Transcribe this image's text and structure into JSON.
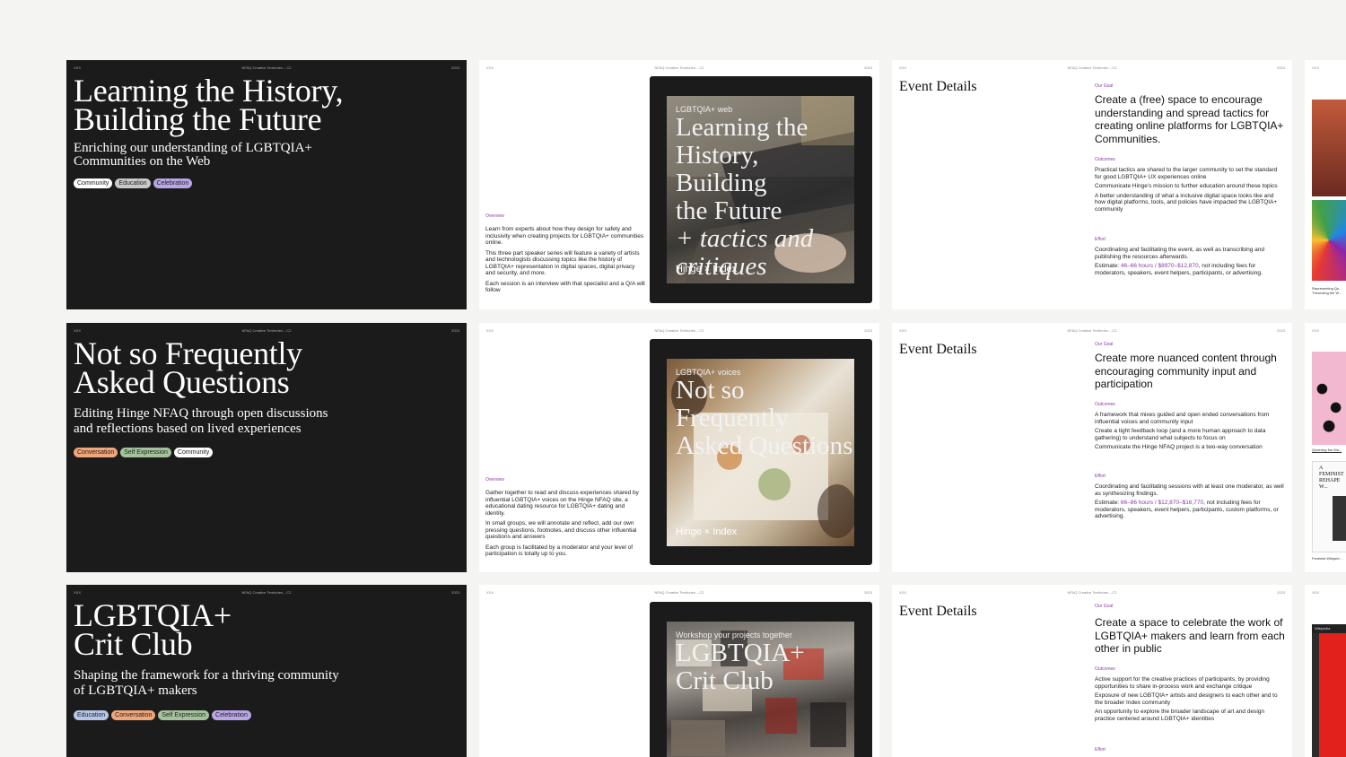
{
  "meta": {
    "left": "XXX",
    "center": "NFAQ Creative Territories – C2",
    "right": "2023"
  },
  "rows": [
    {
      "hero_title": "Learning the History,\nBuilding the Future",
      "hero_sub": "Enriching our understanding of LGBTQIA+\nCommunities on the Web",
      "chips": [
        "Community",
        "Education",
        "Celebration"
      ],
      "overview_label": "Overview",
      "overview": [
        "Learn from experts about how they design for safety and inclusivity when creating projects for LGBTQIA+ communities online.",
        "This three part speaker series will feature a variety of artists and technologists discussing topics like the history of LGBTQIA+ representation in digital spaces, digital privacy and security, and more.",
        "Each session is an interview with that specialist and a Q/A will follow"
      ],
      "poster_kicker": "LGBTQIA+ web",
      "poster_title": "Learning the\nHistory, Building\nthe Future",
      "poster_title_italic": "+ tactics and\ncritiques",
      "brand": "Hinge × Index",
      "event_title": "Event Details",
      "goal_label": "Our Goal",
      "goal": "Create a (free) space to encourage understanding and spread tactics for creating online platforms for LGBTQIA+ Communities.",
      "outcomes_label": "Outcomes",
      "outcomes": [
        "Practical tactics are shared to the larger community to set the standard for good LGBTQIA+ UX experiences online",
        "Communicate Hinge's mission to further education around these topics",
        "A better understanding of what a inclusive digital space looks like and how digital platforms, tools, and policies have impacted the LGBTQIA+ community"
      ],
      "effort_label": "Effort",
      "effort": "Coordinating and facilitating the event, as well as transcribing and publishing the resources afterwards.",
      "estimate_prefix": "Estimate: ",
      "estimate_value": "46–66 hours / $8970–$12,870",
      "estimate_suffix": ", not including fees for moderators, speakers, event helpers, participants, or advertising.",
      "side_caption": "Representing Qu... Theorizing the W..."
    },
    {
      "hero_title": "Not so Frequently\nAsked Questions",
      "hero_sub": "Editing Hinge NFAQ through open discussions\nand reflections based on lived experiences",
      "chips": [
        "Conversation",
        "Self Expression",
        "Community"
      ],
      "overview_label": "Overview",
      "overview": [
        "Gather together to read and discuss experiences shared by influential LGBTQIA+ voices on the Hinge NFAQ site, a educational dating resource for LGBTQIA+ dating and identity.",
        "In small groups, we will annotate and reflect, add our own pressing questions, footnotes, and discuss other influential questions and answers",
        "Each group is facilitated by a moderator and your level of participation is totally up to you."
      ],
      "poster_kicker": "LGBTQIA+ voices",
      "poster_title": "Not so Frequently\nAsked Questions",
      "brand": "Hinge × Index",
      "event_title": "Event Details",
      "goal_label": "Our Goal",
      "goal": "Create more nuanced content through encouraging community input and participation",
      "outcomes_label": "Outcomes",
      "outcomes": [
        "A framework that mixes guided and open ended conversations from influential voices and community input",
        "Create a tight feedback loop (and a more human approach to data gathering) to understand what subjects to focus on",
        "Communicate the Hinge NFAQ project is a two-way conversation"
      ],
      "effort_label": "Effort",
      "effort": "Coordinating and facilitating sessions with at least one moderator, as well as synthesizing findings.",
      "estimate_prefix": "Estimate: ",
      "estimate_value": "66–86 hours / $12,870–$16,770",
      "estimate_suffix": ", not including fees for moderators, speakers, event helpers, participants, custom platforms, or advertising.",
      "side_caption": "Queering the Ma...",
      "side_caption2": "Feminist Wikiped...",
      "side_doc": "A FEMINIST\nREHAPE W..."
    },
    {
      "hero_title": "LGBTQIA+\nCrit Club",
      "hero_sub": "Shaping the framework for a thriving community\nof LGBTQIA+ makers",
      "chips": [
        "Education",
        "Conversation",
        "Self Expression",
        "Celebration"
      ],
      "poster_kicker": "Workshop your projects together",
      "poster_title": "LGBTQIA+\nCrit Club",
      "event_title": "Event Details",
      "goal_label": "Our Goal",
      "goal": "Create a space to celebrate the work of LGBTQIA+ makers and learn from each other in public",
      "outcomes_label": "Outcomes",
      "outcomes": [
        "Active support for the creative practices of participants, by providing opportunities to share in-process work and exchange critique",
        "Exposure of new LGBTQIA+ artists and designers to each other and to the broader Index community",
        "An opportunity to explore the broader landscape of art and design practice centered around LGBTQIA+ identities"
      ],
      "effort_label": "Effort",
      "side_window": "Wikipedia"
    }
  ]
}
